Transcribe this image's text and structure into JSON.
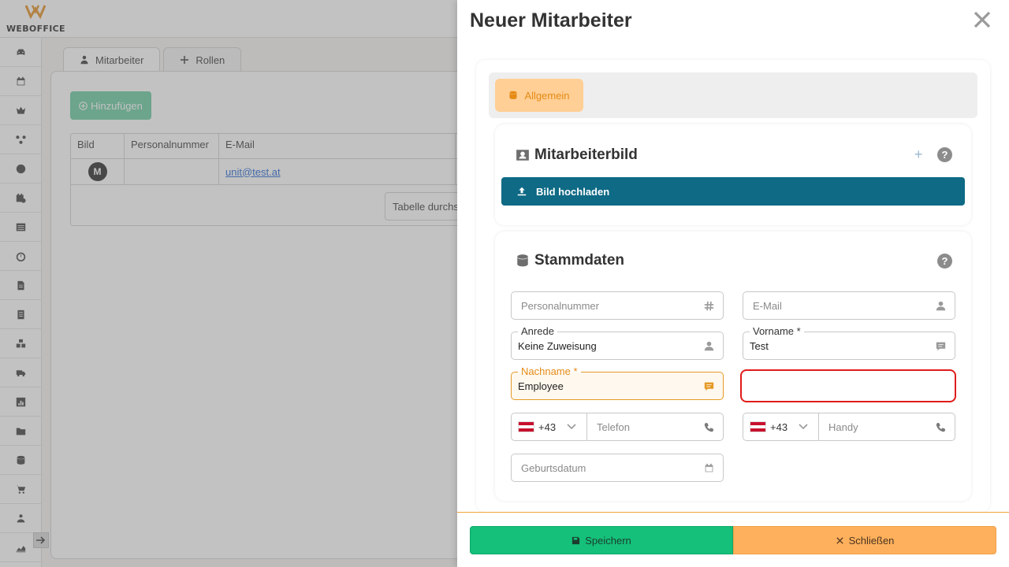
{
  "app": {
    "logo_text": "WEBOFFICE"
  },
  "sidebar": {
    "items": [
      {
        "icon": "car-icon"
      },
      {
        "icon": "calendar-icon"
      },
      {
        "icon": "crown-icon"
      },
      {
        "icon": "network-icon"
      },
      {
        "icon": "clock-icon"
      },
      {
        "icon": "calendar-user-icon"
      },
      {
        "icon": "list-icon"
      },
      {
        "icon": "stopwatch-icon"
      },
      {
        "icon": "document-icon"
      },
      {
        "icon": "receipt-icon"
      },
      {
        "icon": "cubes-icon"
      },
      {
        "icon": "truck-icon"
      },
      {
        "icon": "chart-icon"
      },
      {
        "icon": "folder-icon"
      },
      {
        "icon": "database-icon"
      },
      {
        "icon": "cart-icon"
      },
      {
        "icon": "people-icon"
      },
      {
        "icon": "chart-area-icon"
      }
    ]
  },
  "background": {
    "tabs": [
      {
        "label": "Mitarbeiter",
        "icon": "user-tie-icon"
      },
      {
        "label": "Rollen",
        "icon": "arrows-icon"
      }
    ],
    "add_button": "Hinzufügen",
    "table": {
      "headers": [
        "Bild",
        "Personalnummer",
        "E-Mail"
      ],
      "rows": [
        {
          "avatar": "M",
          "personalnummer": "",
          "email": "unit@test.at"
        }
      ]
    },
    "search_button": "Tabelle durchsuchen"
  },
  "drawer": {
    "title": "Neuer Mitarbeiter",
    "category": "Allgemein",
    "image_card": {
      "title": "Mitarbeiterbild",
      "help": "?",
      "plus": "+",
      "upload_button": "Bild hochladen"
    },
    "master_card": {
      "title": "Stammdaten",
      "help": "?",
      "fields": {
        "personalnummer": {
          "placeholder": "Personalnummer"
        },
        "email": {
          "placeholder": "E-Mail"
        },
        "anrede": {
          "label": "Anrede",
          "value": "Keine Zuweisung"
        },
        "vorname": {
          "label": "Vorname *",
          "value": "Test"
        },
        "nachname": {
          "label": "Nachname *",
          "value": "Employee"
        },
        "telefon": {
          "country_code": "+43",
          "placeholder": "Telefon"
        },
        "handy": {
          "country_code": "+43",
          "placeholder": "Handy"
        },
        "geburtsdatum": {
          "placeholder": "Geburtsdatum"
        }
      }
    },
    "footer": {
      "save": "Speichern",
      "close": "Schließen"
    }
  },
  "colors": {
    "accent_orange": "#e58a14",
    "save_green": "#14c07a",
    "close_orange": "#ffb05c",
    "upload_teal": "#0e6a85",
    "error_red": "#e11b1b"
  }
}
